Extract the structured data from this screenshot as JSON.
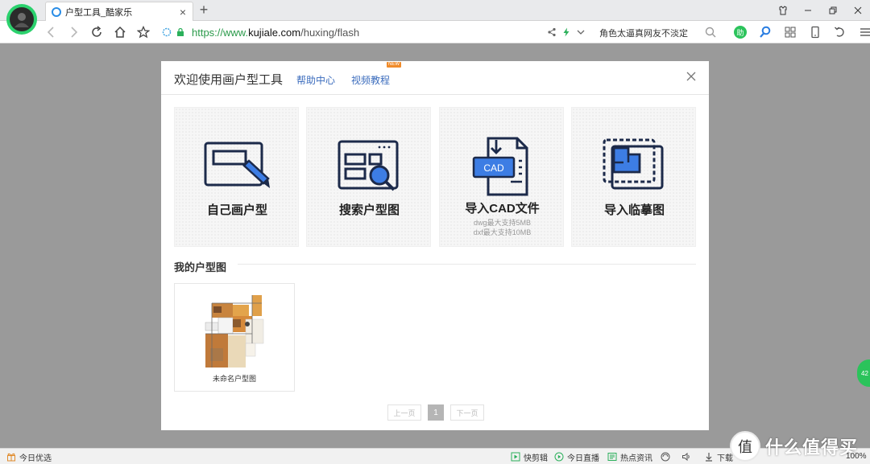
{
  "browser": {
    "tab_title": "户型工具_酷家乐",
    "url_scheme": "https://www.",
    "url_host": "kujiale.com",
    "url_path": "/huxing/flash",
    "search_text": "角色太逼真网友不淡定",
    "assist_label": "助"
  },
  "dialog": {
    "title": "欢迎使用画户型工具",
    "help_link": "帮助中心",
    "video_link": "视频教程",
    "new_badge": "NEW",
    "cards": [
      {
        "label": "自己画户型",
        "icon": "draw-floorplan-icon"
      },
      {
        "label": "搜索户型图",
        "icon": "search-floorplan-icon"
      },
      {
        "label": "导入CAD文件",
        "icon": "import-cad-icon",
        "sub1": "dwg最大支持5MB",
        "sub2": "dxf最大支持10MB",
        "badge": "CAD"
      },
      {
        "label": "导入临摹图",
        "icon": "import-trace-icon"
      }
    ],
    "my_plans_title": "我的户型图",
    "plans": [
      {
        "name": "未命名户型图"
      }
    ],
    "pager": {
      "prev": "上一页",
      "current": "1",
      "next": "下一页"
    }
  },
  "side_float": {
    "label": "42"
  },
  "statusbar": {
    "left": "今日优选",
    "items": [
      "快剪辑",
      "今日直播",
      "热点资讯",
      "下载"
    ],
    "zoom": "100%"
  },
  "watermark": {
    "text": "什么值得买",
    "logo": "值"
  }
}
